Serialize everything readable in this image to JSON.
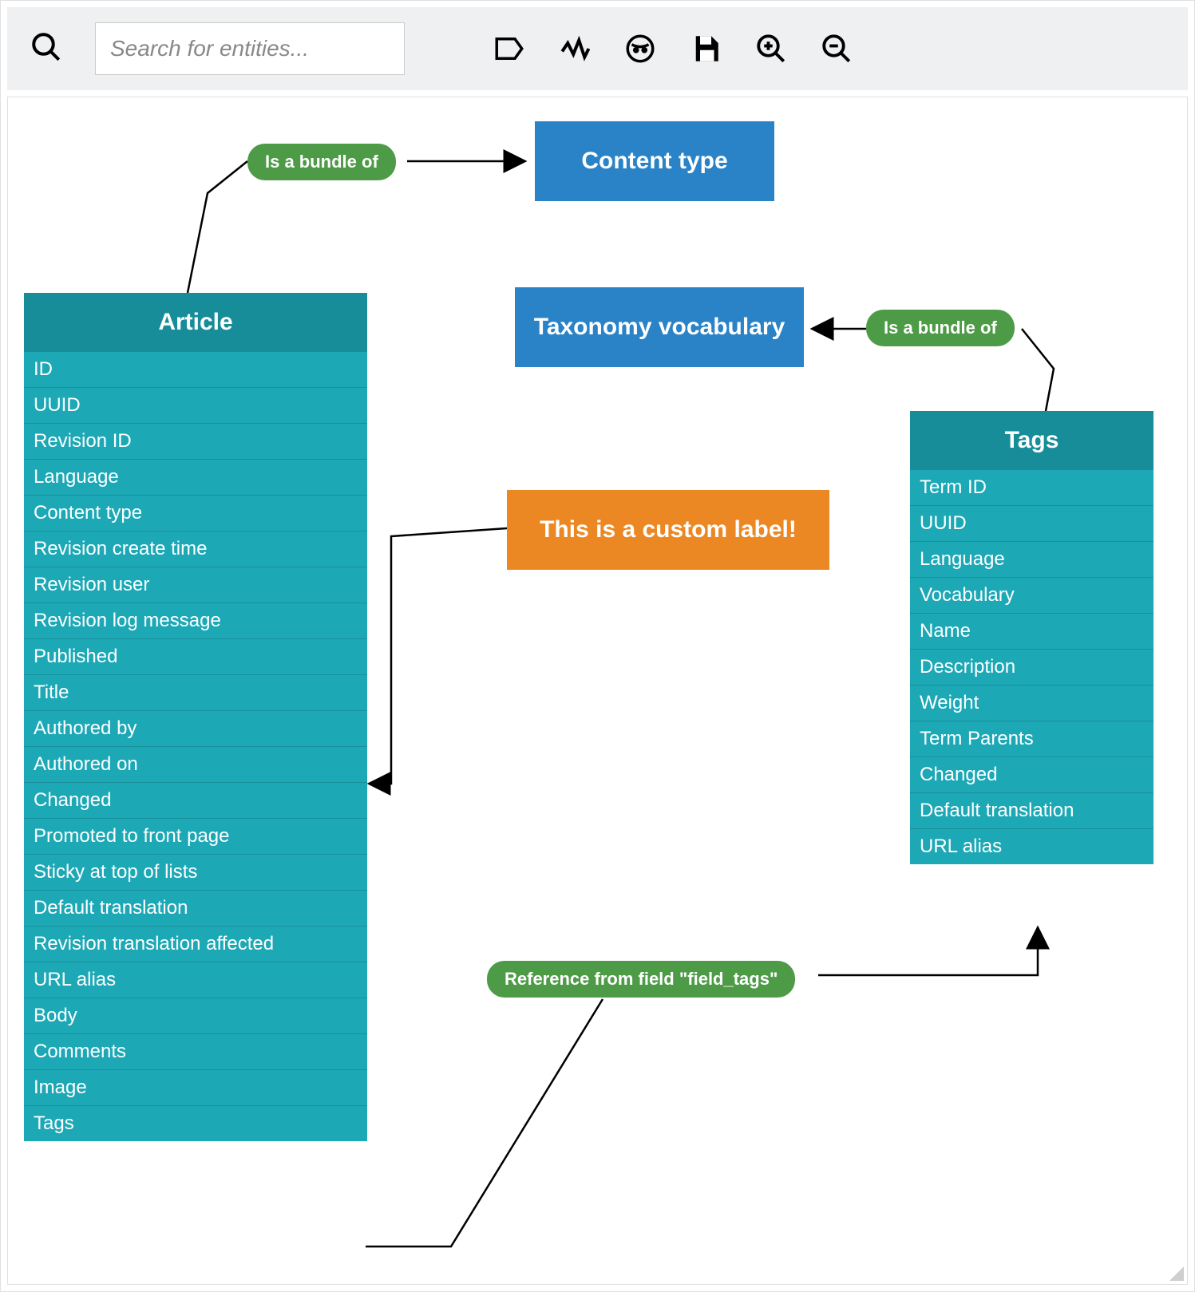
{
  "toolbar": {
    "search_placeholder": "Search for entities..."
  },
  "types": {
    "content_type": "Content type",
    "taxonomy_vocabulary": "Taxonomy vocabulary"
  },
  "labels": {
    "bundle_article": "Is a bundle of",
    "bundle_tags": "Is a bundle of",
    "reference_tags": "Reference from field \"field_tags\"",
    "custom": "This is a custom label!"
  },
  "entities": {
    "article": {
      "title": "Article",
      "fields": [
        "ID",
        "UUID",
        "Revision ID",
        "Language",
        "Content type",
        "Revision create time",
        "Revision user",
        "Revision log message",
        "Published",
        "Title",
        "Authored by",
        "Authored on",
        "Changed",
        "Promoted to front page",
        "Sticky at top of lists",
        "Default translation",
        "Revision translation affected",
        "URL alias",
        "Body",
        "Comments",
        "Image",
        "Tags"
      ]
    },
    "tags": {
      "title": "Tags",
      "fields": [
        "Term ID",
        "UUID",
        "Language",
        "Vocabulary",
        "Name",
        "Description",
        "Weight",
        "Term Parents",
        "Changed",
        "Default translation",
        "URL alias"
      ]
    }
  }
}
